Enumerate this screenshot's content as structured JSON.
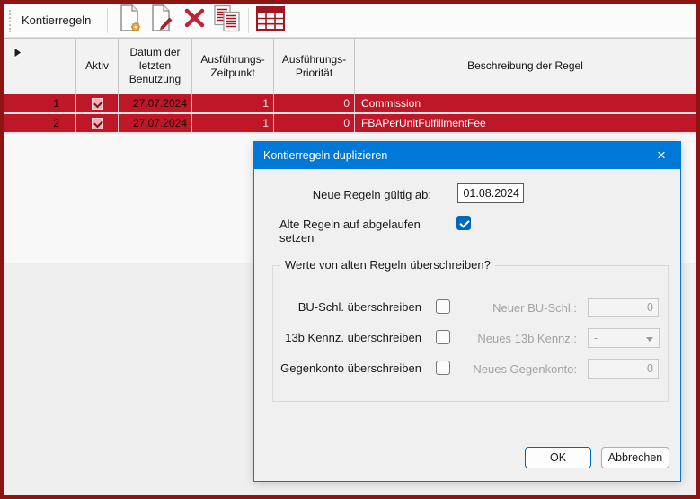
{
  "colors": {
    "window_border": "#8E1313",
    "row_selection_red": "#BE1728",
    "titlebar_blue": "#0078D7",
    "check_blue": "#0067C0",
    "icon_red": "#A31621"
  },
  "toolbar": {
    "title": "Kontierregeln",
    "icons": [
      {
        "name": "new-document-icon"
      },
      {
        "name": "edit-document-icon"
      },
      {
        "name": "delete-icon"
      },
      {
        "name": "duplicate-documents-icon"
      },
      {
        "name": "table-grid-icon"
      }
    ]
  },
  "grid": {
    "columns": [
      "",
      "Aktiv",
      "Datum der letzten Benutzung",
      "Ausführungs-Zeitpunkt",
      "Ausführungs-Priorität",
      "Beschreibung der Regel"
    ],
    "rows": [
      {
        "num": "1",
        "aktiv": "checked",
        "datum": "27.07.2024",
        "zeitpunkt": "1",
        "prioritaet": "0",
        "beschreibung": "Commission",
        "current": false
      },
      {
        "num": "2",
        "aktiv": "checked",
        "datum": "27.07.2024",
        "zeitpunkt": "1",
        "prioritaet": "0",
        "beschreibung": "FBAPerUnitFulfillmentFee",
        "current": true
      }
    ]
  },
  "dialog": {
    "title": "Kontierregeln duplizieren",
    "close_glyph": "×",
    "valid_from_label": "Neue Regeln gültig ab:",
    "valid_from_value": "01.08.2024",
    "expire_old_label": "Alte Regeln auf abgelaufen setzen",
    "expire_old_checked": true,
    "overwrite_group": {
      "legend": "Werte von alten Regeln überschreiben?",
      "rows": [
        {
          "check_label": "BU-Schl. überschreiben",
          "checked": false,
          "value_label": "Neuer BU-Schl.:",
          "value": "0",
          "control": "input"
        },
        {
          "check_label": "13b Kennz. überschreiben",
          "checked": false,
          "value_label": "Neues 13b Kennz.:",
          "value": "-",
          "control": "select"
        },
        {
          "check_label": "Gegenkonto überschreiben",
          "checked": false,
          "value_label": "Neues Gegenkonto:",
          "value": "0",
          "control": "input"
        }
      ]
    },
    "ok_label": "OK",
    "cancel_label": "Abbrechen"
  }
}
